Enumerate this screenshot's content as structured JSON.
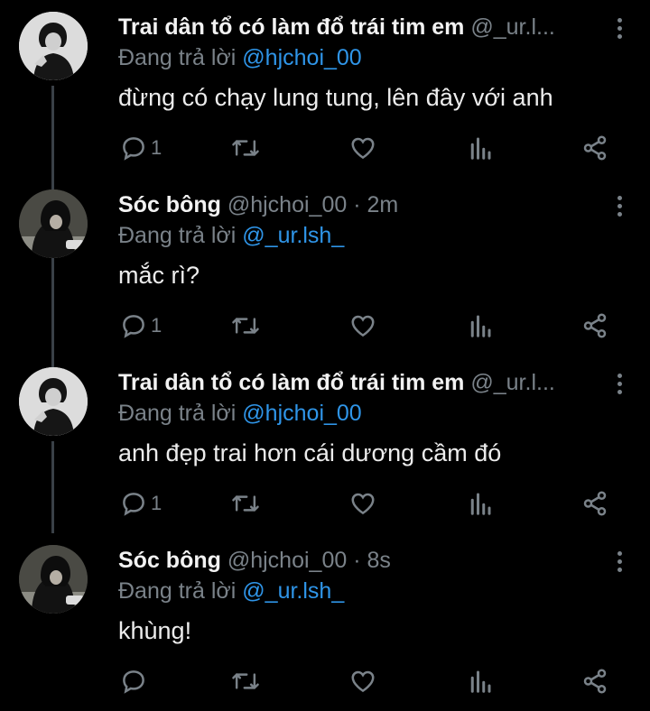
{
  "reply_prefix": "Đang trả lời",
  "tweets": [
    {
      "name": "Trai dân tổ có làm đổ trái tim em",
      "handle_time": "@_ur.l...",
      "reply_to": "@hjchoi_00",
      "text": "đừng có chạy lung tung, lên đây với anh",
      "reply_count": "1",
      "avatar": "avatar-light"
    },
    {
      "name": "Sóc bông",
      "handle_time": "@hjchoi_00 · 2m",
      "reply_to": "@_ur.lsh_",
      "text": "mắc rì?",
      "reply_count": "1",
      "avatar": "avatar-dark"
    },
    {
      "name": "Trai dân tổ có làm đổ trái tim em",
      "handle_time": "@_ur.l...",
      "reply_to": "@hjchoi_00",
      "text": "anh đẹp trai hơn cái dương cầm đó",
      "reply_count": "1",
      "avatar": "avatar-light"
    },
    {
      "name": "Sóc bông",
      "handle_time": "@hjchoi_00 · 8s",
      "reply_to": "@_ur.lsh_",
      "text": "khùng!",
      "reply_count": "",
      "avatar": "avatar-dark"
    }
  ],
  "colors": {
    "background": "#000000",
    "mention": "#2f95e8",
    "muted": "#7a8289",
    "thread_line": "#3a4047"
  },
  "icons": [
    "reply-icon",
    "retweet-icon",
    "like-icon",
    "analytics-icon",
    "share-icon",
    "more-icon"
  ]
}
